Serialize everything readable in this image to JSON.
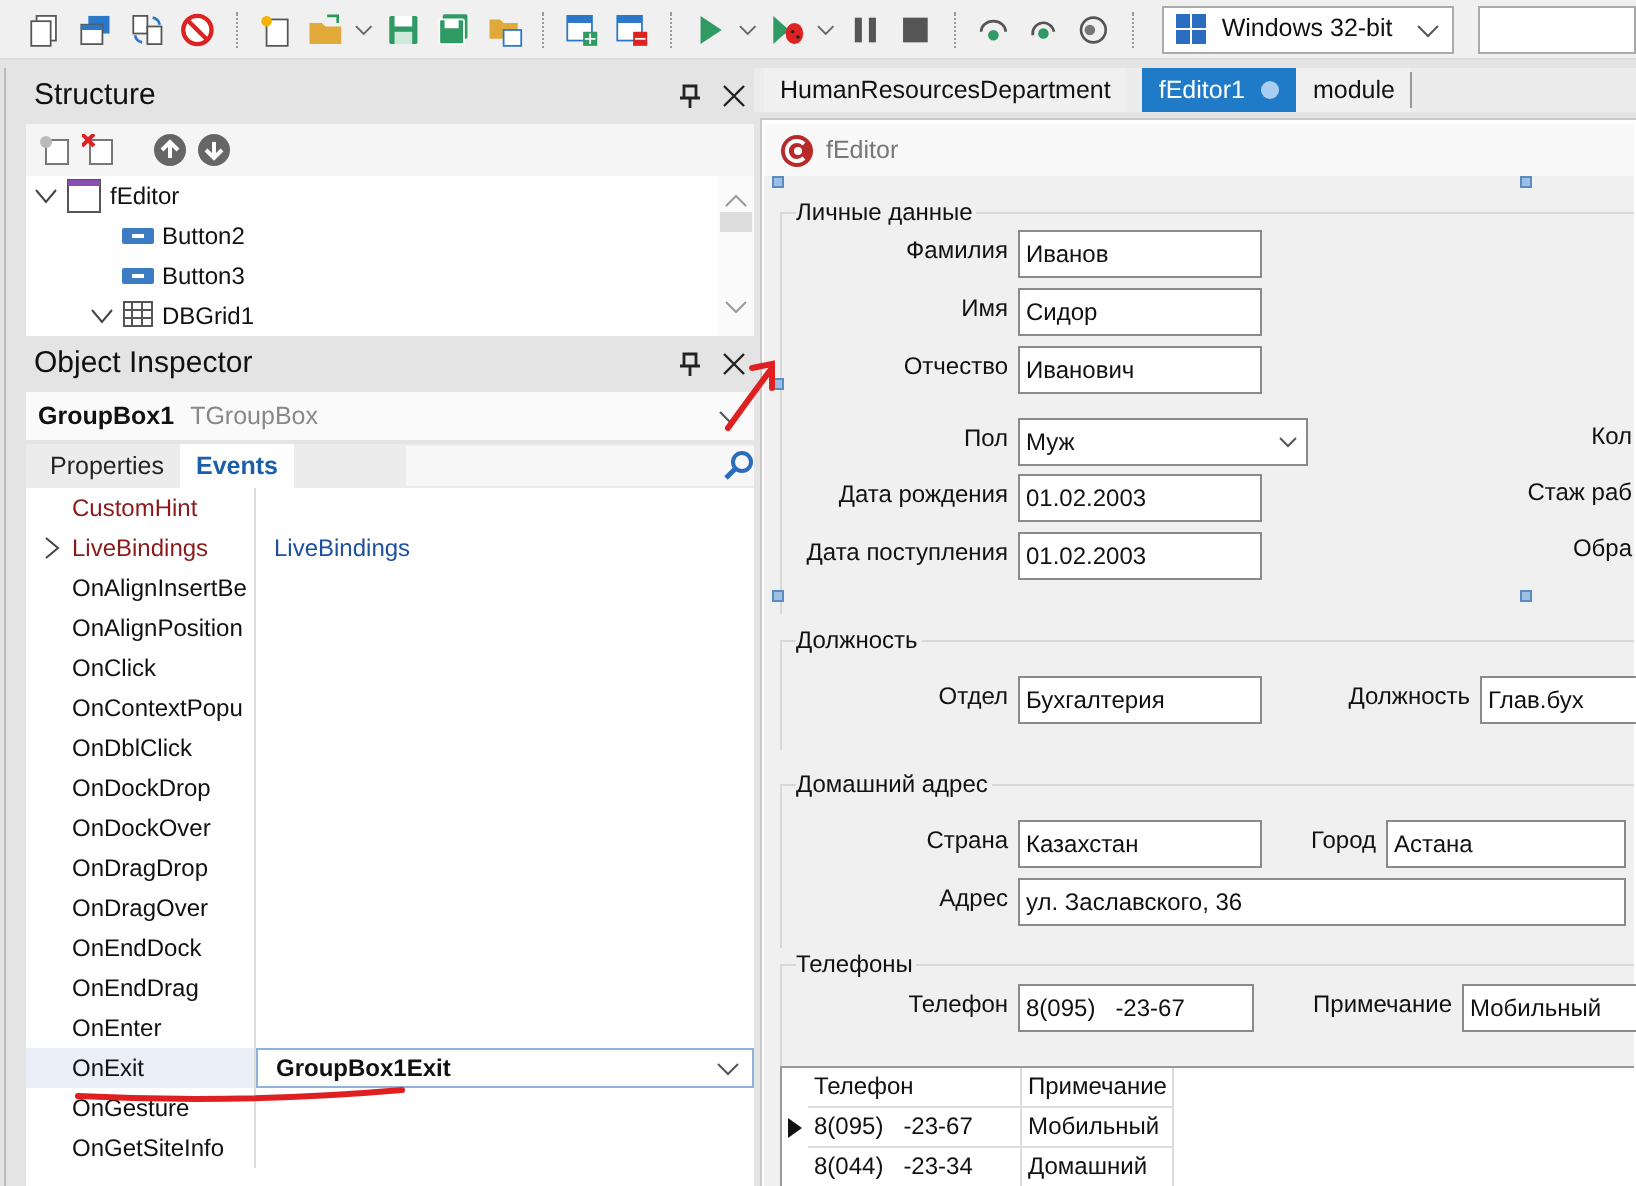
{
  "toolbar": {
    "platform": "Windows 32-bit"
  },
  "structure": {
    "title": "Structure",
    "tree": [
      {
        "label": "fEditor",
        "kind": "form",
        "expanded": true,
        "children": [
          {
            "label": "Button2",
            "kind": "button"
          },
          {
            "label": "Button3",
            "kind": "button"
          },
          {
            "label": "DBGrid1",
            "kind": "grid",
            "expanded": true
          }
        ]
      }
    ]
  },
  "object_inspector": {
    "title": "Object Inspector",
    "component": {
      "name": "GroupBox1",
      "type": "TGroupBox"
    },
    "tabs": [
      {
        "label": "Properties",
        "selected": false
      },
      {
        "label": "Events",
        "selected": true
      }
    ],
    "rows": [
      {
        "name": "CustomHint",
        "kind": "reference",
        "selected": false
      },
      {
        "name": "LiveBindings",
        "kind": "reference",
        "expanded": false,
        "value": "LiveBindings",
        "selected": false
      },
      {
        "name": "OnAlignInsertBe",
        "kind": "event",
        "selected": false
      },
      {
        "name": "OnAlignPosition",
        "kind": "event",
        "selected": false
      },
      {
        "name": "OnClick",
        "kind": "event",
        "selected": false
      },
      {
        "name": "OnContextPopu",
        "kind": "event",
        "selected": false
      },
      {
        "name": "OnDblClick",
        "kind": "event",
        "selected": false
      },
      {
        "name": "OnDockDrop",
        "kind": "event",
        "selected": false
      },
      {
        "name": "OnDockOver",
        "kind": "event",
        "selected": false
      },
      {
        "name": "OnDragDrop",
        "kind": "event",
        "selected": false
      },
      {
        "name": "OnDragOver",
        "kind": "event",
        "selected": false
      },
      {
        "name": "OnEndDock",
        "kind": "event",
        "selected": false
      },
      {
        "name": "OnEndDrag",
        "kind": "event",
        "selected": false
      },
      {
        "name": "OnEnter",
        "kind": "event",
        "selected": false
      },
      {
        "name": "OnExit",
        "kind": "event",
        "value": "GroupBox1Exit",
        "selected": true
      },
      {
        "name": "OnGesture",
        "kind": "event",
        "selected": false
      },
      {
        "name": "OnGetSiteInfo",
        "kind": "event",
        "selected": false
      }
    ]
  },
  "editor_tabs": [
    {
      "label": "HumanResourcesDepartment",
      "selected": false,
      "modified": false
    },
    {
      "label": "fEditor1",
      "selected": true,
      "modified": true
    },
    {
      "label": "module",
      "selected": false,
      "modified": false
    }
  ],
  "form": {
    "caption": "fEditor",
    "sections": [
      {
        "title": "Личные данные",
        "fields": [
          {
            "label": "Фамилия",
            "value": "Иванов",
            "kind": "edit"
          },
          {
            "label": "Имя",
            "value": "Сидор",
            "kind": "edit"
          },
          {
            "label": "Отчество",
            "value": "Иванович",
            "kind": "edit"
          },
          {
            "label": "Пол",
            "value": "Муж",
            "kind": "combo"
          },
          {
            "label": "Дата рождения",
            "value": "01.02.2003",
            "kind": "edit"
          },
          {
            "label": "Дата поступления",
            "value": "01.02.2003",
            "kind": "edit"
          },
          {
            "label": "Кол",
            "kind": "label"
          },
          {
            "label": "Стаж раб",
            "kind": "label"
          },
          {
            "label": "Обра",
            "kind": "label"
          }
        ]
      },
      {
        "title": "Должность",
        "fields": [
          {
            "label": "Отдел",
            "value": "Бухгалтерия",
            "kind": "edit"
          },
          {
            "label": "Должность",
            "value": "Глав.бух",
            "kind": "edit"
          }
        ]
      },
      {
        "title": "Домашний адрес",
        "fields": [
          {
            "label": "Страна",
            "value": "Казахстан",
            "kind": "edit"
          },
          {
            "label": "Город",
            "value": "Астана",
            "kind": "edit"
          },
          {
            "label": "Адрес",
            "value": "ул. Заславского, 36",
            "kind": "edit"
          }
        ]
      },
      {
        "title": "Телефоны",
        "fields": [
          {
            "label": "Телефон",
            "value": "8(095)   -23-67",
            "kind": "edit"
          },
          {
            "label": "Примечание",
            "value": "Мобильный",
            "kind": "edit"
          }
        ]
      }
    ],
    "grid": {
      "columns": [
        "Телефон",
        "Примечание"
      ],
      "rows": [
        {
          "cells": [
            "8(095)   -23-67",
            "Мобильный"
          ],
          "current": true
        },
        {
          "cells": [
            "8(044)   -23-34",
            "Домашний"
          ],
          "current": false
        }
      ]
    }
  }
}
